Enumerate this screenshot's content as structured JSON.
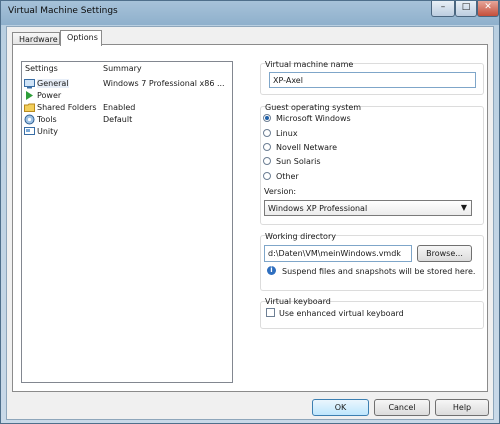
{
  "window": {
    "title": "Virtual Machine Settings"
  },
  "tabs": [
    {
      "label": "Hardware"
    },
    {
      "label": "Options"
    }
  ],
  "list": {
    "headers": {
      "settings": "Settings",
      "summary": "Summary"
    },
    "items": [
      {
        "name": "General",
        "summary": "Windows 7 Professional x86 ...",
        "icon": "general-icon"
      },
      {
        "name": "Power",
        "summary": "",
        "icon": "power-icon"
      },
      {
        "name": "Shared Folders",
        "summary": "Enabled",
        "icon": "shared-folders-icon"
      },
      {
        "name": "Tools",
        "summary": "Default",
        "icon": "tools-icon"
      },
      {
        "name": "Unity",
        "summary": "",
        "icon": "unity-icon"
      }
    ]
  },
  "vmname": {
    "label": "Virtual machine name",
    "value": "XP-Axel"
  },
  "guestos": {
    "label": "Guest operating system",
    "options": [
      "Microsoft Windows",
      "Linux",
      "Novell Netware",
      "Sun Solaris",
      "Other"
    ],
    "selected_index": 0,
    "version_label": "Version:",
    "version_value": "Windows XP Professional"
  },
  "workdir": {
    "label": "Working directory",
    "value": "d:\\Daten\\VM\\meinWindows.vmdk",
    "browse": "Browse...",
    "info": "Suspend files and snapshots will be stored here."
  },
  "keyboard": {
    "label": "Virtual keyboard",
    "checkbox": "Use enhanced virtual keyboard",
    "checked": false
  },
  "buttons": {
    "ok": "OK",
    "cancel": "Cancel",
    "help": "Help"
  },
  "colors": {
    "accent": "#1f5fa8",
    "title_bar": "#8fb0cc"
  }
}
